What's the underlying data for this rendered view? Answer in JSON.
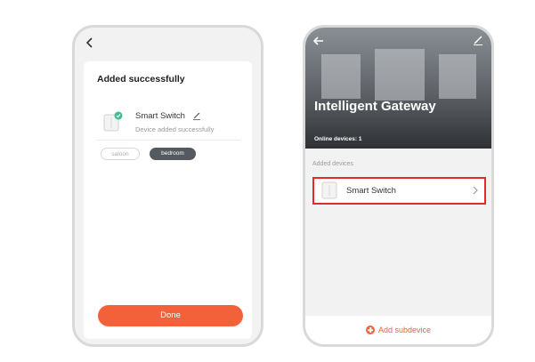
{
  "left_screen": {
    "card_title": "Added successfully",
    "device_name": "Smart Switch",
    "device_status": "Device added successfully",
    "rooms": [
      "saloon",
      "bedroom"
    ],
    "selected_room": "bedroom",
    "done_label": "Done"
  },
  "right_screen": {
    "title": "Intelligent Gateway",
    "online_devices": "Online devices: 1",
    "section_label": "Added devices",
    "device_name": "Smart Switch",
    "add_subdevice_label": "Add subdevice"
  },
  "colors": {
    "accent": "#f2613a",
    "highlight_border": "#e12b2b",
    "chip_selected": "#555a60"
  },
  "icons": [
    "back-arrow-icon",
    "edit-icon",
    "device-switch-icon",
    "check-badge-icon",
    "chevron-right-icon",
    "plus-circle-icon"
  ]
}
